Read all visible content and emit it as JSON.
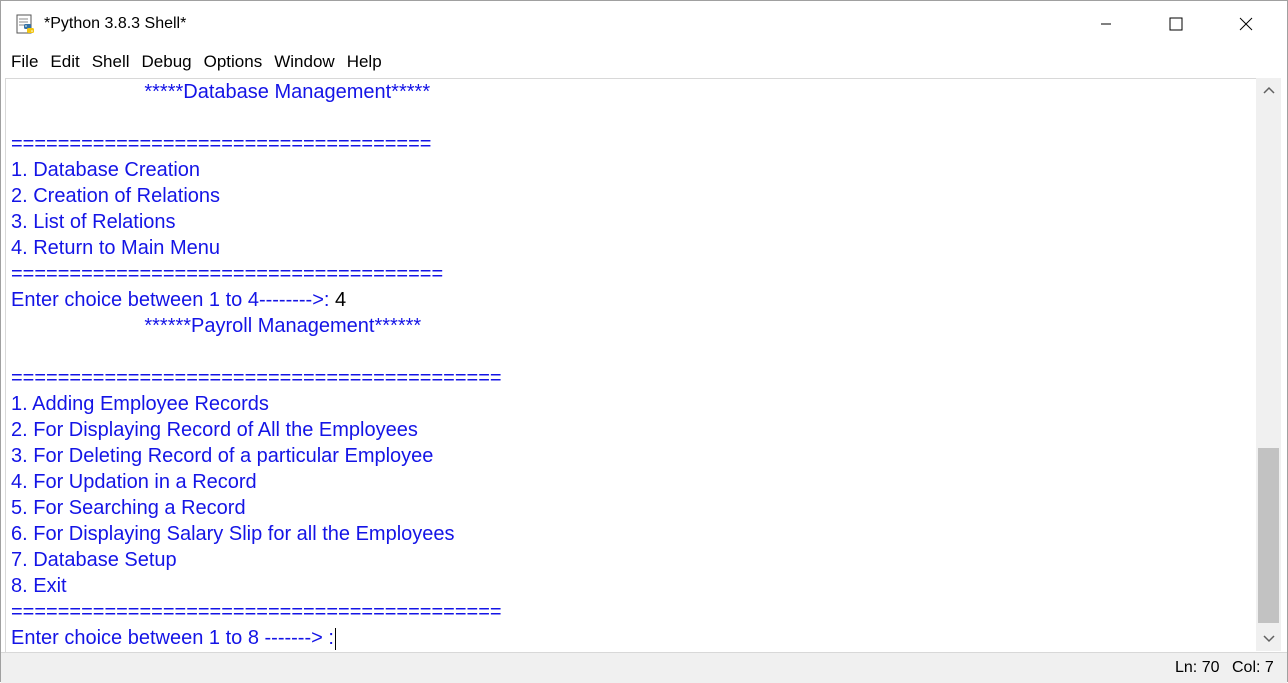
{
  "window": {
    "title": "*Python 3.8.3 Shell*"
  },
  "menu": {
    "items": [
      "File",
      "Edit",
      "Shell",
      "Debug",
      "Options",
      "Window",
      "Help"
    ]
  },
  "shell": {
    "lines": [
      {
        "text": "                        *****Database Management*****",
        "input": ""
      },
      {
        "text": "",
        "input": ""
      },
      {
        "text": "====================================",
        "input": ""
      },
      {
        "text": "1. Database Creation",
        "input": ""
      },
      {
        "text": "2. Creation of Relations",
        "input": ""
      },
      {
        "text": "3. List of Relations",
        "input": ""
      },
      {
        "text": "4. Return to Main Menu",
        "input": ""
      },
      {
        "text": "=====================================",
        "input": ""
      },
      {
        "text": "Enter choice between 1 to 4-------->: ",
        "input": "4"
      },
      {
        "text": "                        ******Payroll Management******",
        "input": ""
      },
      {
        "text": "",
        "input": ""
      },
      {
        "text": "==========================================",
        "input": ""
      },
      {
        "text": "1. Adding Employee Records",
        "input": ""
      },
      {
        "text": "2. For Displaying Record of All the Employees",
        "input": ""
      },
      {
        "text": "3. For Deleting Record of a particular Employee",
        "input": ""
      },
      {
        "text": "4. For Updation in a Record",
        "input": ""
      },
      {
        "text": "5. For Searching a Record",
        "input": ""
      },
      {
        "text": "6. For Displaying Salary Slip for all the Employees",
        "input": ""
      },
      {
        "text": "7. Database Setup",
        "input": ""
      },
      {
        "text": "8. Exit",
        "input": ""
      },
      {
        "text": "==========================================",
        "input": ""
      },
      {
        "text": "Enter choice between 1 to 8 -------> :",
        "input": ""
      }
    ]
  },
  "status": {
    "ln": "Ln: 70",
    "col": "Col: 7"
  },
  "colors": {
    "output": "#1414e6",
    "input": "#000000"
  }
}
